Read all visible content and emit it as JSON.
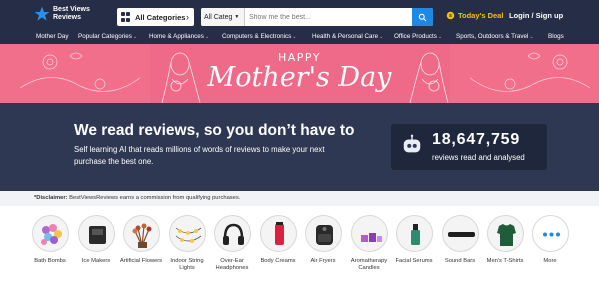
{
  "header": {
    "logo_text": "Best Views Reviews",
    "all_categories_label": "All Categories",
    "search": {
      "category_value": "All Categ",
      "placeholder": "Show me the best..."
    },
    "todays_deal_label": "Today's Deal",
    "login_label": "Login / Sign up"
  },
  "nav": {
    "items": [
      {
        "label": "Mother Day",
        "dropdown": false
      },
      {
        "label": "Popular Categories",
        "dropdown": true
      },
      {
        "label": "Home & Appliances",
        "dropdown": true
      },
      {
        "label": "Computers & Electronics",
        "dropdown": true
      },
      {
        "label": "Health & Personal Care",
        "dropdown": true
      },
      {
        "label": "Office Products",
        "dropdown": true
      },
      {
        "label": "Sports, Outdoors & Travel",
        "dropdown": true
      },
      {
        "label": "Blogs",
        "dropdown": false
      }
    ]
  },
  "banner": {
    "line1": "HAPPY",
    "line2": "Mother's Day"
  },
  "hero": {
    "headline": "We read reviews, so you don’t have to",
    "subtext": "Self learning AI that reads millions of words of reviews to make your next purchase the best one.",
    "counter_value": "18,647,759",
    "counter_caption": "reviews read and analysed"
  },
  "disclaimer": {
    "label": "*Disclaimer:",
    "text": " BestViewsReviews earns a commission from qualifying purchases."
  },
  "categories": [
    {
      "label": "Bath Bombs",
      "icon": "bath-bombs-icon"
    },
    {
      "label": "Ice Makers",
      "icon": "ice-maker-icon"
    },
    {
      "label": "Artificial Flowers",
      "icon": "artificial-flowers-icon"
    },
    {
      "label": "Indoor String Lights",
      "icon": "string-lights-icon"
    },
    {
      "label": "Over-Ear Headphones",
      "icon": "headphones-icon"
    },
    {
      "label": "Body Creams",
      "icon": "body-cream-icon"
    },
    {
      "label": "Air Fryers",
      "icon": "air-fryer-icon"
    },
    {
      "label": "Aromatherapy Candles",
      "icon": "candles-icon"
    },
    {
      "label": "Facial Serums",
      "icon": "serum-icon"
    },
    {
      "label": "Sound Bars",
      "icon": "sound-bar-icon"
    },
    {
      "label": "Men's T-Shirts",
      "icon": "tshirt-icon"
    },
    {
      "label": "More",
      "icon": "more-dots-icon"
    }
  ],
  "colors": {
    "header_bg": "#262e47",
    "accent_blue": "#1e88e5",
    "deal_yellow": "#f6c000",
    "banner_pink": "#f26f8c",
    "hero_bg": "#2f3853"
  }
}
